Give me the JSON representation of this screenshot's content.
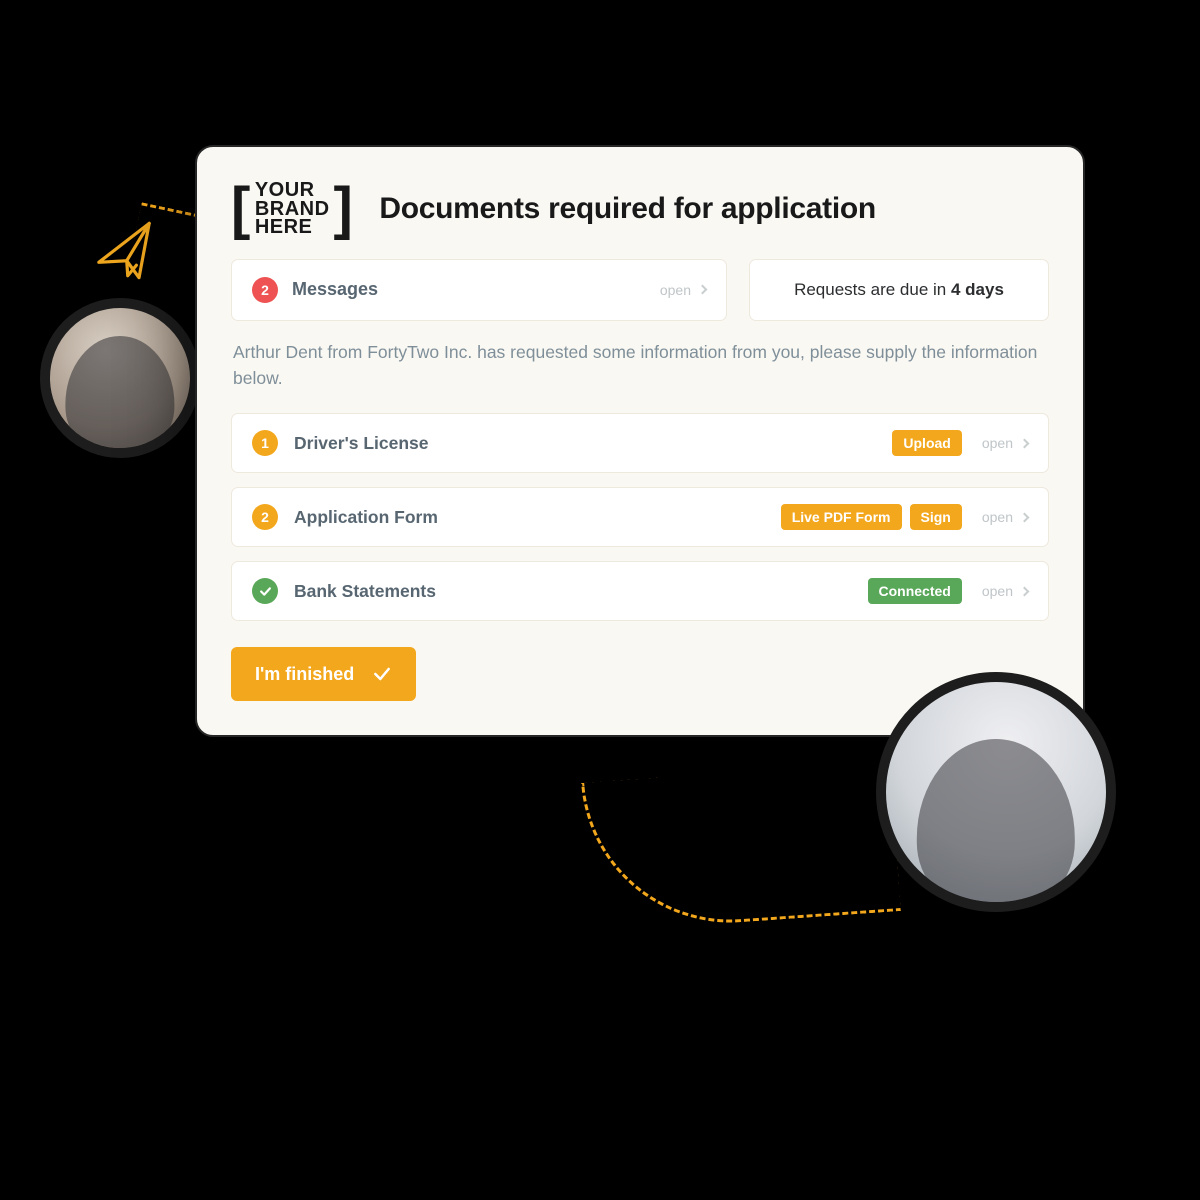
{
  "logo": {
    "line1": "YOUR",
    "line2": "BRAND",
    "line3": "HERE"
  },
  "title": "Documents required for application",
  "messages": {
    "count": "2",
    "label": "Messages",
    "open": "open"
  },
  "due": {
    "prefix": "Requests are due in ",
    "bold": "4 days"
  },
  "description": "Arthur Dent from FortyTwo Inc. has requested some information from you, please supply the information below.",
  "requests": [
    {
      "num": "1",
      "label": "Driver's License",
      "tags": [
        {
          "text": "Upload",
          "color": "amber"
        }
      ],
      "open": "open",
      "done": false
    },
    {
      "num": "2",
      "label": "Application Form",
      "tags": [
        {
          "text": "Live PDF Form",
          "color": "amber"
        },
        {
          "text": "Sign",
          "color": "amber"
        }
      ],
      "open": "open",
      "done": false
    },
    {
      "num": "",
      "label": "Bank Statements",
      "tags": [
        {
          "text": "Connected",
          "color": "green"
        }
      ],
      "open": "open",
      "done": true
    }
  ],
  "finish": "I'm finished",
  "colors": {
    "amber": "#eea61e",
    "red": "#ee5252",
    "green": "#59a758"
  }
}
